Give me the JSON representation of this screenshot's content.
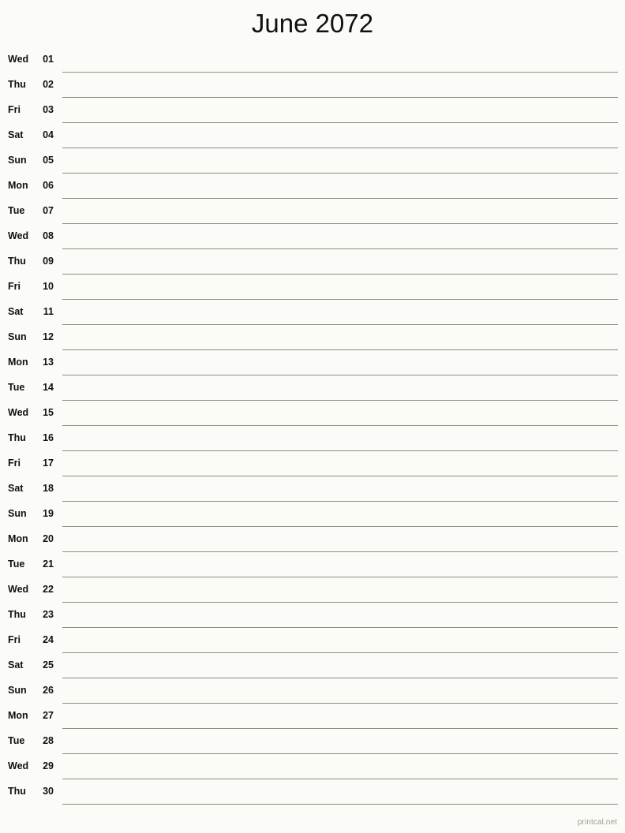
{
  "page": {
    "title": "June 2072",
    "background_color": "#fbfcf8",
    "line_color": "#8a8f86",
    "text_color": "#101010"
  },
  "footer": {
    "credit": "printcal.net"
  },
  "calendar": {
    "month": "June",
    "year": "2072",
    "days": [
      {
        "weekday": "Wed",
        "number": "01"
      },
      {
        "weekday": "Thu",
        "number": "02"
      },
      {
        "weekday": "Fri",
        "number": "03"
      },
      {
        "weekday": "Sat",
        "number": "04"
      },
      {
        "weekday": "Sun",
        "number": "05"
      },
      {
        "weekday": "Mon",
        "number": "06"
      },
      {
        "weekday": "Tue",
        "number": "07"
      },
      {
        "weekday": "Wed",
        "number": "08"
      },
      {
        "weekday": "Thu",
        "number": "09"
      },
      {
        "weekday": "Fri",
        "number": "10"
      },
      {
        "weekday": "Sat",
        "number": "11"
      },
      {
        "weekday": "Sun",
        "number": "12"
      },
      {
        "weekday": "Mon",
        "number": "13"
      },
      {
        "weekday": "Tue",
        "number": "14"
      },
      {
        "weekday": "Wed",
        "number": "15"
      },
      {
        "weekday": "Thu",
        "number": "16"
      },
      {
        "weekday": "Fri",
        "number": "17"
      },
      {
        "weekday": "Sat",
        "number": "18"
      },
      {
        "weekday": "Sun",
        "number": "19"
      },
      {
        "weekday": "Mon",
        "number": "20"
      },
      {
        "weekday": "Tue",
        "number": "21"
      },
      {
        "weekday": "Wed",
        "number": "22"
      },
      {
        "weekday": "Thu",
        "number": "23"
      },
      {
        "weekday": "Fri",
        "number": "24"
      },
      {
        "weekday": "Sat",
        "number": "25"
      },
      {
        "weekday": "Sun",
        "number": "26"
      },
      {
        "weekday": "Mon",
        "number": "27"
      },
      {
        "weekday": "Tue",
        "number": "28"
      },
      {
        "weekday": "Wed",
        "number": "29"
      },
      {
        "weekday": "Thu",
        "number": "30"
      }
    ]
  }
}
